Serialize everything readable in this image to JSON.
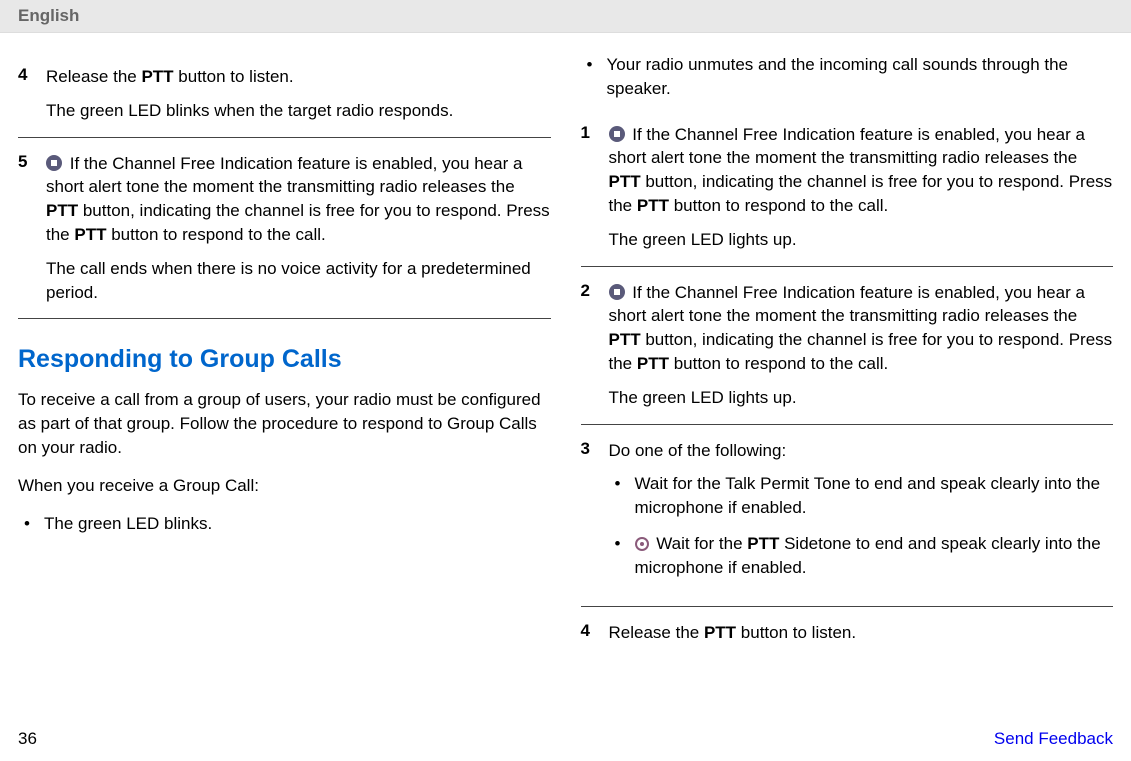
{
  "header": {
    "title": "English"
  },
  "left": {
    "step4": {
      "num": "4",
      "line1_a": "Release the ",
      "line1_b": "PTT",
      "line1_c": " button to listen.",
      "line2": "The green LED blinks when the target radio responds."
    },
    "step5": {
      "num": "5",
      "line1_a": "If the Channel Free Indication feature is enabled, you hear a short alert tone the moment the transmitting radio releases the ",
      "line1_b": "PTT",
      "line1_c": " button, indicating the channel is free for you to respond. Press the ",
      "line1_d": "PTT",
      "line1_e": " button to respond to the call.",
      "line2": "The call ends when there is no voice activity for a predetermined period."
    },
    "heading": "Responding to Group Calls",
    "intro": "To receive a call from a group of users, your radio must be configured as part of that group. Follow the procedure to respond to Group Calls on your radio.",
    "lead": "When you receive a Group Call:",
    "bullet1": "The green LED blinks."
  },
  "right": {
    "bullet1": "Your radio unmutes and the incoming call sounds through the speaker.",
    "step1": {
      "num": "1",
      "line1_a": "If the Channel Free Indication feature is enabled, you hear a short alert tone the moment the transmitting radio releases the ",
      "line1_b": "PTT",
      "line1_c": " button, indicating the channel is free for you to respond. Press the ",
      "line1_d": "PTT",
      "line1_e": " button to respond to the call.",
      "line2": "The green LED lights up."
    },
    "step2": {
      "num": "2",
      "line1_a": "If the Channel Free Indication feature is enabled, you hear a short alert tone the moment the transmitting radio releases the ",
      "line1_b": "PTT",
      "line1_c": " button, indicating the channel is free for you to respond. Press the ",
      "line1_d": "PTT",
      "line1_e": " button to respond to the call.",
      "line2": "The green LED lights up."
    },
    "step3": {
      "num": "3",
      "line1": "Do one of the following:",
      "sub1": "Wait for the Talk Permit Tone to end and speak clearly into the microphone if enabled.",
      "sub2_a": "Wait for the ",
      "sub2_b": "PTT",
      "sub2_c": " Sidetone to end and speak clearly into the microphone if enabled."
    },
    "step4": {
      "num": "4",
      "line1_a": "Release the ",
      "line1_b": "PTT",
      "line1_c": " button to listen."
    }
  },
  "footer": {
    "page": "36",
    "feedback": "Send Feedback"
  }
}
